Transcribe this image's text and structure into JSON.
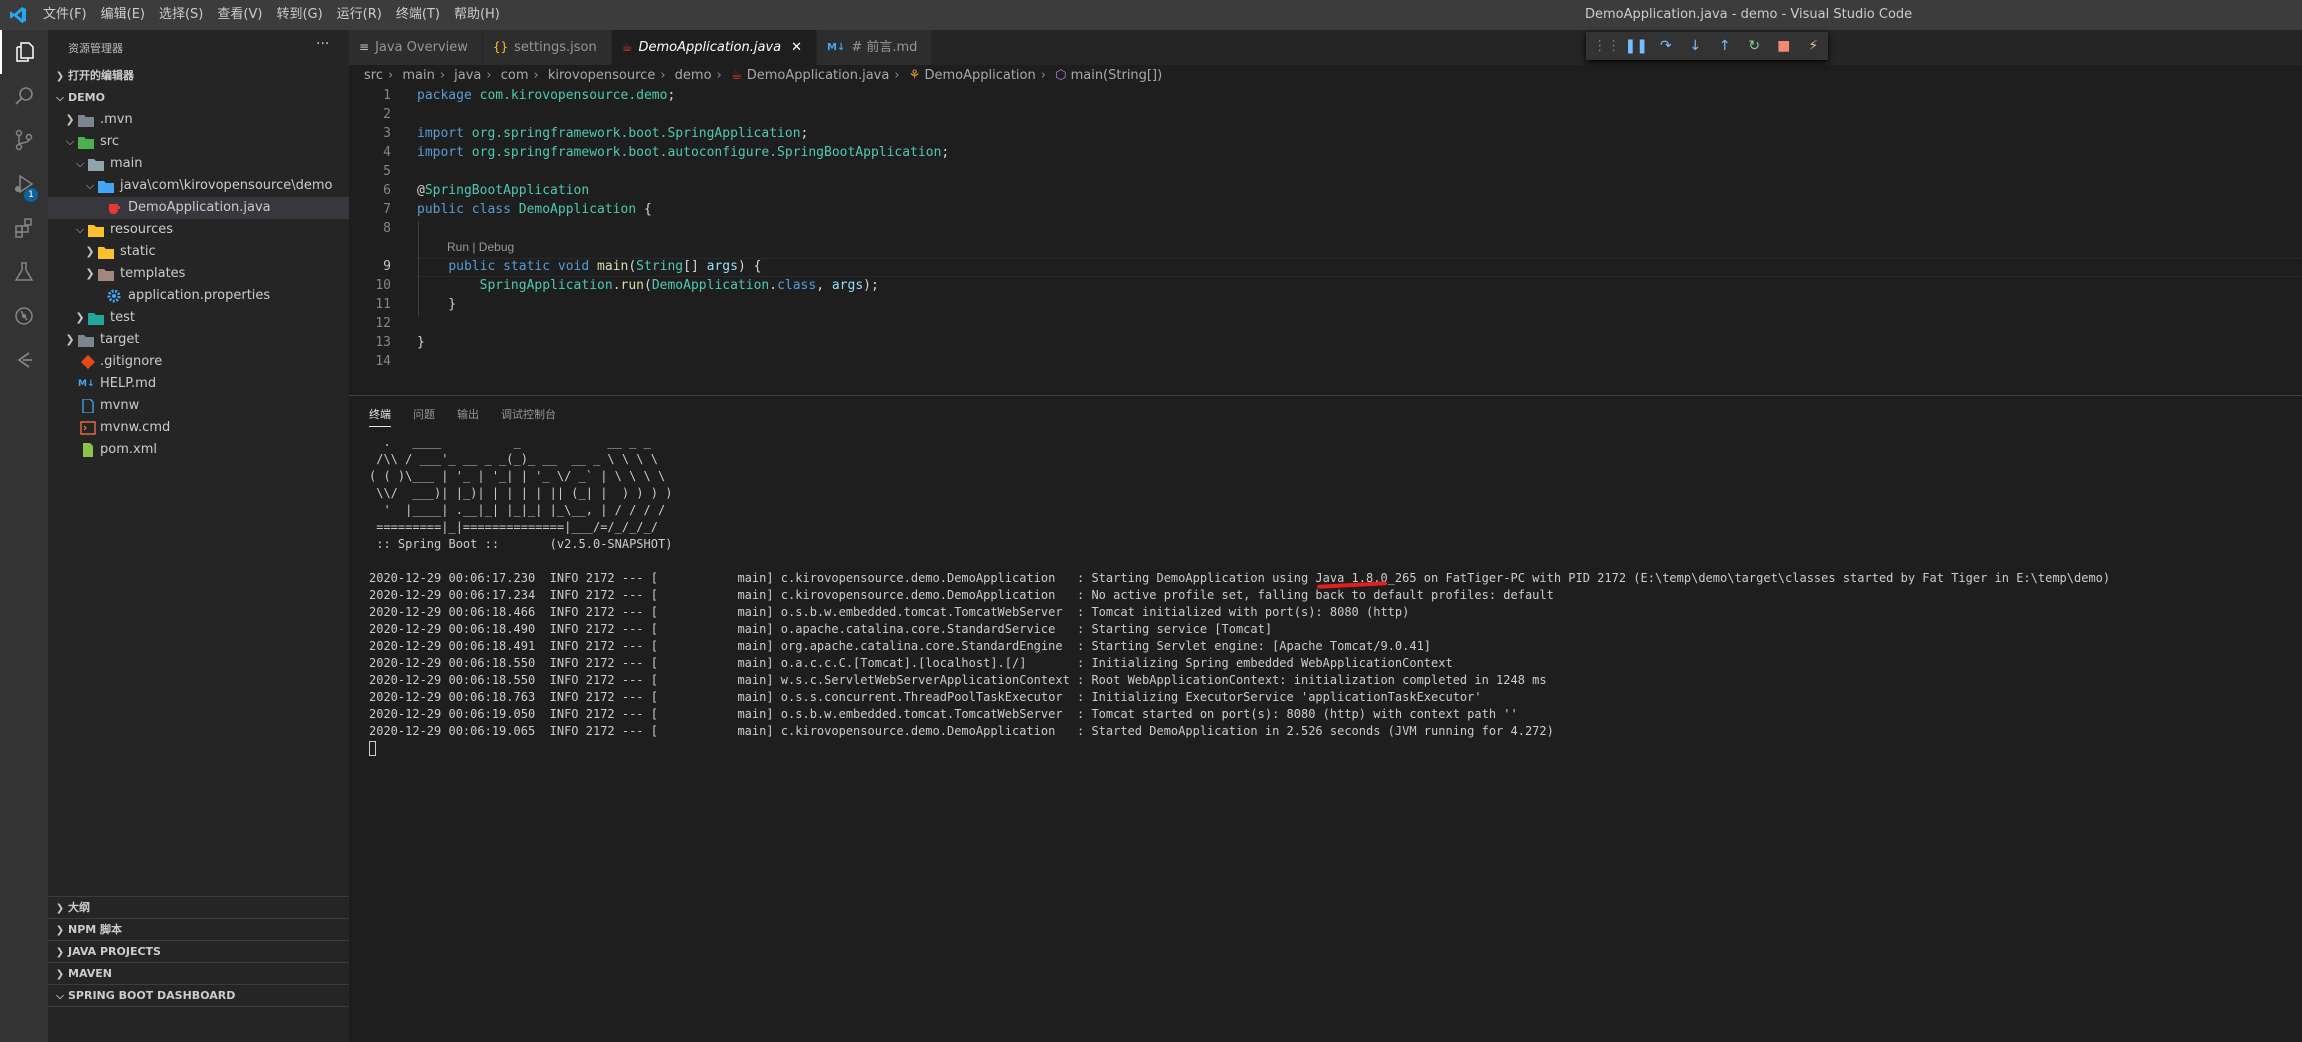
{
  "window": {
    "title": "DemoApplication.java - demo - Visual Studio Code"
  },
  "menu": [
    "文件(F)",
    "编辑(E)",
    "选择(S)",
    "查看(V)",
    "转到(G)",
    "运行(R)",
    "终端(T)",
    "帮助(H)"
  ],
  "activity": {
    "run_badge": "1"
  },
  "sidebar": {
    "title": "资源管理器",
    "more": "···",
    "open_editors": "打开的编辑器",
    "root": "DEMO",
    "tree": [
      ".mvn",
      "src",
      "main",
      "java\\com\\kirovopensource\\demo",
      "DemoApplication.java",
      "resources",
      "static",
      "templates",
      "application.properties",
      "test",
      "target",
      ".gitignore",
      "HELP.md",
      "mvnw",
      "mvnw.cmd",
      "pom.xml"
    ],
    "bottom_sections": [
      "大纲",
      "NPM 脚本",
      "JAVA PROJECTS",
      "MAVEN",
      "SPRING BOOT DASHBOARD"
    ]
  },
  "tabs": [
    {
      "icon": "≡",
      "label": "Java Overview",
      "close": ""
    },
    {
      "icon": "{}",
      "label": "settings.json",
      "close": ""
    },
    {
      "icon": "☕",
      "label": "DemoApplication.java",
      "close": "✕"
    },
    {
      "icon": "M↓",
      "label": "# 前言.md",
      "close": ""
    }
  ],
  "breadcrumb": [
    "src",
    "main",
    "java",
    "com",
    "kirovopensource",
    "demo",
    "DemoApplication.java",
    "DemoApplication",
    "main(String[])"
  ],
  "editor": {
    "line_numbers": [
      "1",
      "2",
      "3",
      "4",
      "5",
      "6",
      "7",
      "8",
      "9",
      "10",
      "11",
      "12",
      "13",
      "14"
    ],
    "codelens": "Run | Debug",
    "lines": [
      [
        [
          "kw",
          "package "
        ],
        [
          "ty",
          "com.kirovopensource.demo"
        ],
        [
          "",
          "; "
        ]
      ],
      [],
      [
        [
          "kw",
          "import "
        ],
        [
          "ty",
          "org.springframework.boot.SpringApplication"
        ],
        [
          "",
          ";"
        ]
      ],
      [
        [
          "kw",
          "import "
        ],
        [
          "ty",
          "org.springframework.boot.autoconfigure.SpringBootApplication"
        ],
        [
          "",
          ";"
        ]
      ],
      [],
      [
        [
          "",
          "@"
        ],
        [
          "ty",
          "SpringBootApplication"
        ]
      ],
      [
        [
          "kw",
          "public class "
        ],
        [
          "ty",
          "DemoApplication"
        ],
        [
          "",
          " {"
        ]
      ],
      [],
      [
        [
          "",
          "    "
        ],
        [
          "kw",
          "public static void "
        ],
        [
          "fn",
          "main"
        ],
        [
          "",
          "("
        ],
        [
          "ty",
          "String"
        ],
        [
          "",
          "[] "
        ],
        [
          "vr",
          "args"
        ],
        [
          "",
          ") {"
        ]
      ],
      [
        [
          "",
          "        "
        ],
        [
          "ty",
          "SpringApplication"
        ],
        [
          "",
          "."
        ],
        [
          "fn",
          "run"
        ],
        [
          "",
          "("
        ],
        [
          "ty",
          "DemoApplication"
        ],
        [
          "",
          "."
        ],
        [
          "kw",
          "class"
        ],
        [
          "",
          ", "
        ],
        [
          "vr",
          "args"
        ],
        [
          "",
          ");"
        ]
      ],
      [
        [
          "",
          "    }"
        ]
      ],
      [],
      [
        [
          "",
          "}"
        ]
      ],
      []
    ]
  },
  "panel": {
    "tabs": [
      "终端",
      "问题",
      "输出",
      "调试控制台"
    ],
    "terminal_lines": [
      "  .   ____          _            __ _ _",
      " /\\\\ / ___'_ __ _ _(_)_ __  __ _ \\ \\ \\ \\",
      "( ( )\\___ | '_ | '_| | '_ \\/ _` | \\ \\ \\ \\",
      " \\\\/  ___)| |_)| | | | | || (_| |  ) ) ) )",
      "  '  |____| .__|_| |_|_| |_\\__, | / / / /",
      " =========|_|==============|___/=/_/_/_/",
      " :: Spring Boot ::       (v2.5.0-SNAPSHOT)",
      "",
      "2020-12-29 00:06:17.230  INFO 2172 --- [           main] c.kirovopensource.demo.DemoApplication   : Starting DemoApplication using Java 1.8.0_265 on FatTiger-PC with PID 2172 (E:\\temp\\demo\\target\\classes started by Fat Tiger in E:\\temp\\demo)",
      "2020-12-29 00:06:17.234  INFO 2172 --- [           main] c.kirovopensource.demo.DemoApplication   : No active profile set, falling back to default profiles: default",
      "2020-12-29 00:06:18.466  INFO 2172 --- [           main] o.s.b.w.embedded.tomcat.TomcatWebServer  : Tomcat initialized with port(s): 8080 (http)",
      "2020-12-29 00:06:18.490  INFO 2172 --- [           main] o.apache.catalina.core.StandardService   : Starting service [Tomcat]",
      "2020-12-29 00:06:18.491  INFO 2172 --- [           main] org.apache.catalina.core.StandardEngine  : Starting Servlet engine: [Apache Tomcat/9.0.41]",
      "2020-12-29 00:06:18.550  INFO 2172 --- [           main] o.a.c.c.C.[Tomcat].[localhost].[/]       : Initializing Spring embedded WebApplicationContext",
      "2020-12-29 00:06:18.550  INFO 2172 --- [           main] w.s.c.ServletWebServerApplicationContext : Root WebApplicationContext: initialization completed in 1248 ms",
      "2020-12-29 00:06:18.763  INFO 2172 --- [           main] o.s.s.concurrent.ThreadPoolTaskExecutor  : Initializing ExecutorService 'applicationTaskExecutor'",
      "2020-12-29 00:06:19.050  INFO 2172 --- [           main] o.s.b.w.embedded.tomcat.TomcatWebServer  : Tomcat started on port(s): 8080 (http) with context path ''",
      "2020-12-29 00:06:19.065  INFO 2172 --- [           main] c.kirovopensource.demo.DemoApplication   : Started DemoApplication in 2.526 seconds (JVM running for 4.272)"
    ]
  },
  "colors": {
    "accent": "#007acc",
    "annotation": "#e02020"
  }
}
